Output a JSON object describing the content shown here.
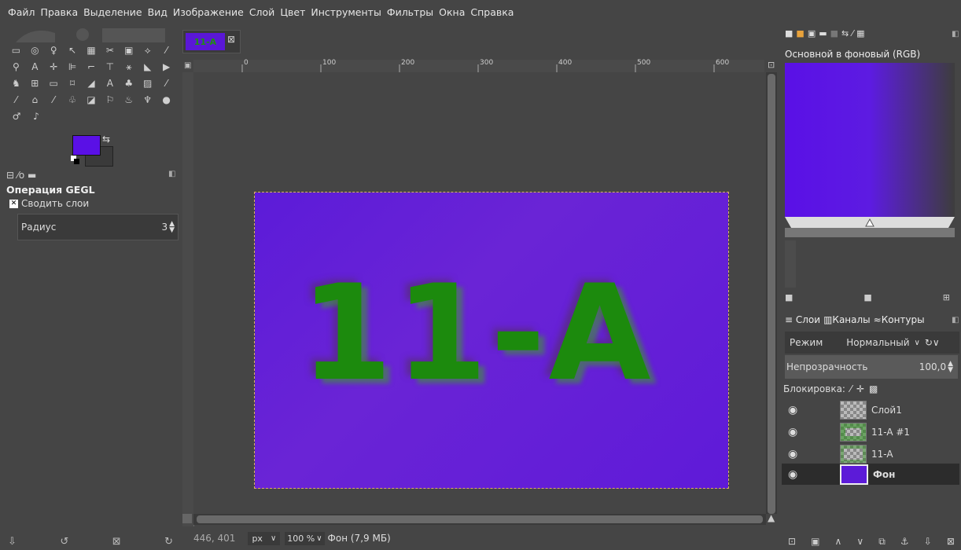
{
  "menubar": {
    "items": [
      "Файл",
      "Правка",
      "Выделение",
      "Вид",
      "Изображение",
      "Слой",
      "Цвет",
      "Инструменты",
      "Фильтры",
      "Окна",
      "Справка"
    ]
  },
  "toolbox": {
    "tool_options_title": "Операция GEGL",
    "merge_layers_label": "Сводить слои",
    "radius_label": "Радиус",
    "radius_value": "3",
    "fg_color": "#5a10e6",
    "bg_color": "#3a3a3a"
  },
  "canvas": {
    "tab_label": "11-A",
    "image_text": "11-A",
    "ruler_marks": [
      "0",
      "100",
      "200",
      "300",
      "400",
      "500",
      "600"
    ],
    "image_bg": "#5c1bd8",
    "text_color": "#1c8a0d"
  },
  "status": {
    "coords": "446, 401",
    "unit": "px",
    "zoom": "100 %",
    "layer_info": "Фон (7,9 МБ)"
  },
  "right_panel": {
    "gradient_name": "Основной в фоновый (RGB)",
    "tabs": [
      "Слои",
      "Каналы",
      "Контуры"
    ],
    "mode_label": "Режим",
    "mode_value": "Нормальный",
    "opacity_label": "Непрозрачность",
    "opacity_value": "100,0",
    "lock_label": "Блокировка:",
    "layers": [
      {
        "name": "Слой1"
      },
      {
        "name": "11-A #1"
      },
      {
        "name": "11-A"
      },
      {
        "name": "Фон"
      }
    ]
  }
}
